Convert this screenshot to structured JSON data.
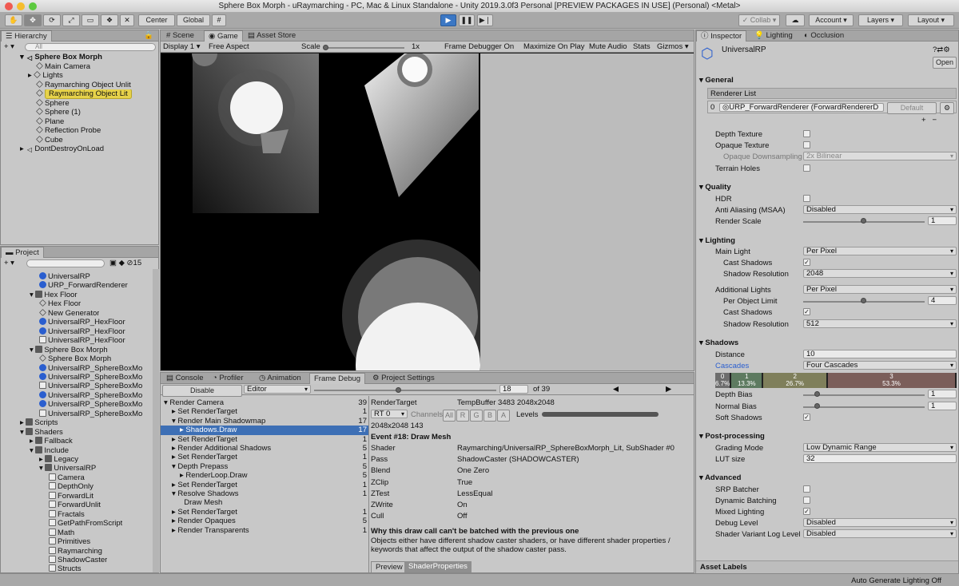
{
  "window": {
    "title": "Sphere Box Morph - uRaymarching - PC, Mac & Linux Standalone - Unity 2019.3.0f3 Personal [PREVIEW PACKAGES IN USE] (Personal) <Metal>"
  },
  "toolbar": {
    "center": "Center",
    "global": "Global",
    "collab": "Collab",
    "account": "Account",
    "layers": "Layers",
    "layout": "Layout"
  },
  "hierarchy": {
    "tab": "Hierarchy",
    "search_placeholder": "All",
    "scene": "Sphere Box Morph",
    "items": [
      "Main Camera",
      "Lights",
      "Raymarching Object Unlit",
      "Raymarching Object Lit",
      "Sphere",
      "Sphere (1)",
      "Plane",
      "Reflection Probe",
      "Cube"
    ],
    "dontdestroy": "DontDestroyOnLoad"
  },
  "project": {
    "tab": "Project",
    "count": "15",
    "items": [
      {
        "t": "UniversalRP",
        "d": 3,
        "k": "blue"
      },
      {
        "t": "URP_ForwardRenderer",
        "d": 3,
        "k": "blue"
      },
      {
        "t": "Hex Floor",
        "d": 2,
        "k": "folder"
      },
      {
        "t": "Hex Floor",
        "d": 3,
        "k": "cube"
      },
      {
        "t": "New Generator",
        "d": 3,
        "k": "cube"
      },
      {
        "t": "UniversalRP_HexFloor",
        "d": 3,
        "k": "blue"
      },
      {
        "t": "UniversalRP_HexFloor",
        "d": 3,
        "k": "blue"
      },
      {
        "t": "UniversalRP_HexFloor",
        "d": 3,
        "k": "file"
      },
      {
        "t": "Sphere Box Morph",
        "d": 2,
        "k": "folder"
      },
      {
        "t": "Sphere Box Morph",
        "d": 3,
        "k": "cube"
      },
      {
        "t": "UniversalRP_SphereBoxMo",
        "d": 3,
        "k": "blue"
      },
      {
        "t": "UniversalRP_SphereBoxMo",
        "d": 3,
        "k": "blue"
      },
      {
        "t": "UniversalRP_SphereBoxMo",
        "d": 3,
        "k": "file"
      },
      {
        "t": "UniversalRP_SphereBoxMo",
        "d": 3,
        "k": "blue"
      },
      {
        "t": "UniversalRP_SphereBoxMo",
        "d": 3,
        "k": "blue"
      },
      {
        "t": "UniversalRP_SphereBoxMo",
        "d": 3,
        "k": "file"
      },
      {
        "t": "Scripts",
        "d": 1,
        "k": "folder"
      },
      {
        "t": "Shaders",
        "d": 1,
        "k": "folder"
      },
      {
        "t": "Fallback",
        "d": 2,
        "k": "folder"
      },
      {
        "t": "Include",
        "d": 2,
        "k": "folder"
      },
      {
        "t": "Legacy",
        "d": 3,
        "k": "folder"
      },
      {
        "t": "UniversalRP",
        "d": 3,
        "k": "folder"
      },
      {
        "t": "Camera",
        "d": 4,
        "k": "file"
      },
      {
        "t": "DepthOnly",
        "d": 4,
        "k": "file"
      },
      {
        "t": "ForwardLit",
        "d": 4,
        "k": "file"
      },
      {
        "t": "ForwardUnlit",
        "d": 4,
        "k": "file"
      },
      {
        "t": "Fractals",
        "d": 4,
        "k": "file"
      },
      {
        "t": "GetPathFromScript",
        "d": 4,
        "k": "file"
      },
      {
        "t": "Math",
        "d": 4,
        "k": "file"
      },
      {
        "t": "Primitives",
        "d": 4,
        "k": "file"
      },
      {
        "t": "Raymarching",
        "d": 4,
        "k": "file"
      },
      {
        "t": "ShadowCaster",
        "d": 4,
        "k": "file"
      },
      {
        "t": "Structs",
        "d": 4,
        "k": "file"
      }
    ]
  },
  "scene_view": {
    "tabs": [
      "Scene",
      "Game",
      "Asset Store"
    ],
    "display": "Display 1",
    "aspect": "Free Aspect",
    "scale_label": "Scale",
    "scale_value": "1x",
    "frame_debugger": "Frame Debugger On",
    "maximize": "Maximize On Play",
    "mute": "Mute Audio",
    "stats": "Stats",
    "gizmos": "Gizmos"
  },
  "bottom": {
    "tabs": [
      "Console",
      "Profiler",
      "Animation",
      "Frame Debug",
      "Project Settings"
    ],
    "disable": "Disable",
    "editor": "Editor",
    "frame": "18",
    "of": "of 39",
    "tree": [
      {
        "t": "Render Camera",
        "n": "39",
        "d": 0
      },
      {
        "t": "Set RenderTarget",
        "n": "1",
        "d": 1
      },
      {
        "t": "Render Main Shadowmap",
        "n": "17",
        "d": 1
      },
      {
        "t": "Shadows.Draw",
        "n": "17",
        "d": 2
      },
      {
        "t": "Set RenderTarget",
        "n": "1",
        "d": 1
      },
      {
        "t": "Render Additional Shadows",
        "n": "5",
        "d": 1
      },
      {
        "t": "Set RenderTarget",
        "n": "1",
        "d": 1
      },
      {
        "t": "Depth Prepass",
        "n": "5",
        "d": 1
      },
      {
        "t": "RenderLoop.Draw",
        "n": "5",
        "d": 2
      },
      {
        "t": "Set RenderTarget",
        "n": "1",
        "d": 1
      },
      {
        "t": "Resolve Shadows",
        "n": "1",
        "d": 1
      },
      {
        "t": "Draw Mesh",
        "n": "",
        "d": 2
      },
      {
        "t": "Set RenderTarget",
        "n": "1",
        "d": 1
      },
      {
        "t": "Render Opaques",
        "n": "5",
        "d": 1
      },
      {
        "t": "Render Transparents",
        "n": "1",
        "d": 1
      }
    ],
    "rendertarget_label": "RenderTarget",
    "rendertarget_value": "TempBuffer 3483 2048x2048",
    "rt": "RT 0",
    "channels": [
      "Channels",
      "All",
      "R",
      "G",
      "B",
      "A"
    ],
    "levels": "Levels",
    "size": "2048x2048 143",
    "event": "Event #18: Draw Mesh",
    "props": [
      {
        "k": "Shader",
        "v": "Raymarching/UniversalRP_SphereBoxMorph_Lit, SubShader #0"
      },
      {
        "k": "Pass",
        "v": "ShadowCaster (SHADOWCASTER)"
      },
      {
        "k": "Blend",
        "v": "One Zero"
      },
      {
        "k": "ZClip",
        "v": "True"
      },
      {
        "k": "ZTest",
        "v": "LessEqual"
      },
      {
        "k": "ZWrite",
        "v": "On"
      },
      {
        "k": "Cull",
        "v": "Off"
      }
    ],
    "why_title": "Why this draw call can't be batched with the previous one",
    "why_text": "Objects either have different shadow caster shaders, or have different shader properties / keywords that affect the output of the shadow caster pass.",
    "preview_tabs": [
      "Preview",
      "ShaderProperties"
    ]
  },
  "inspector": {
    "tabs": [
      "Inspector",
      "Lighting",
      "Occlusion"
    ],
    "asset": "UniversalRP",
    "open": "Open",
    "general": "General",
    "renderer_list": "Renderer List",
    "renderer_index": "0",
    "renderer": "URP_ForwardRenderer (ForwardRendererD",
    "default": "Default",
    "depth_texture": "Depth Texture",
    "opaque_texture": "Opaque Texture",
    "opaque_down": "Opaque Downsampling",
    "opaque_down_val": "2x Bilinear",
    "terrain_holes": "Terrain Holes",
    "quality": "Quality",
    "hdr": "HDR",
    "aa": "Anti Aliasing (MSAA)",
    "aa_val": "Disabled",
    "render_scale": "Render Scale",
    "render_scale_val": "1",
    "render_scale_frac": 0.5,
    "lighting": "Lighting",
    "main_light": "Main Light",
    "main_light_val": "Per Pixel",
    "cast_shadows": "Cast Shadows",
    "shadow_res": "Shadow Resolution",
    "shadow_res_val": "2048",
    "add_lights": "Additional Lights",
    "add_lights_val": "Per Pixel",
    "per_obj": "Per Object Limit",
    "per_obj_val": "4",
    "per_obj_frac": 0.5,
    "add_cast": "Cast Shadows",
    "add_res": "Shadow Resolution",
    "add_res_val": "512",
    "shadows": "Shadows",
    "distance": "Distance",
    "distance_val": "10",
    "cascades": "Cascades",
    "cascades_val": "Four Cascades",
    "cascade_bar": [
      {
        "n": "0",
        "p": "6.7%",
        "c": "#6d6d6d",
        "w": 6.7
      },
      {
        "n": "1",
        "p": "13.3%",
        "c": "#5d7a60",
        "w": 13.3
      },
      {
        "n": "2",
        "p": "26.7%",
        "c": "#7f7f5b",
        "w": 26.7
      },
      {
        "n": "3",
        "p": "53.3%",
        "c": "#7b5e5a",
        "w": 53.3
      }
    ],
    "depth_bias": "Depth Bias",
    "depth_bias_val": "1",
    "normal_bias": "Normal Bias",
    "normal_bias_val": "1",
    "soft": "Soft Shadows",
    "post": "Post-processing",
    "grading": "Grading Mode",
    "grading_val": "Low Dynamic Range",
    "lut": "LUT size",
    "lut_val": "32",
    "advanced": "Advanced",
    "srp": "SRP Batcher",
    "dyn": "Dynamic Batching",
    "mixed": "Mixed Lighting",
    "debug": "Debug Level",
    "debug_val": "Disabled",
    "svll": "Shader Variant Log Level",
    "svll_val": "Disabled",
    "asset_labels": "Asset Labels"
  },
  "status": {
    "auto_gen": "Auto Generate Lighting Off"
  }
}
